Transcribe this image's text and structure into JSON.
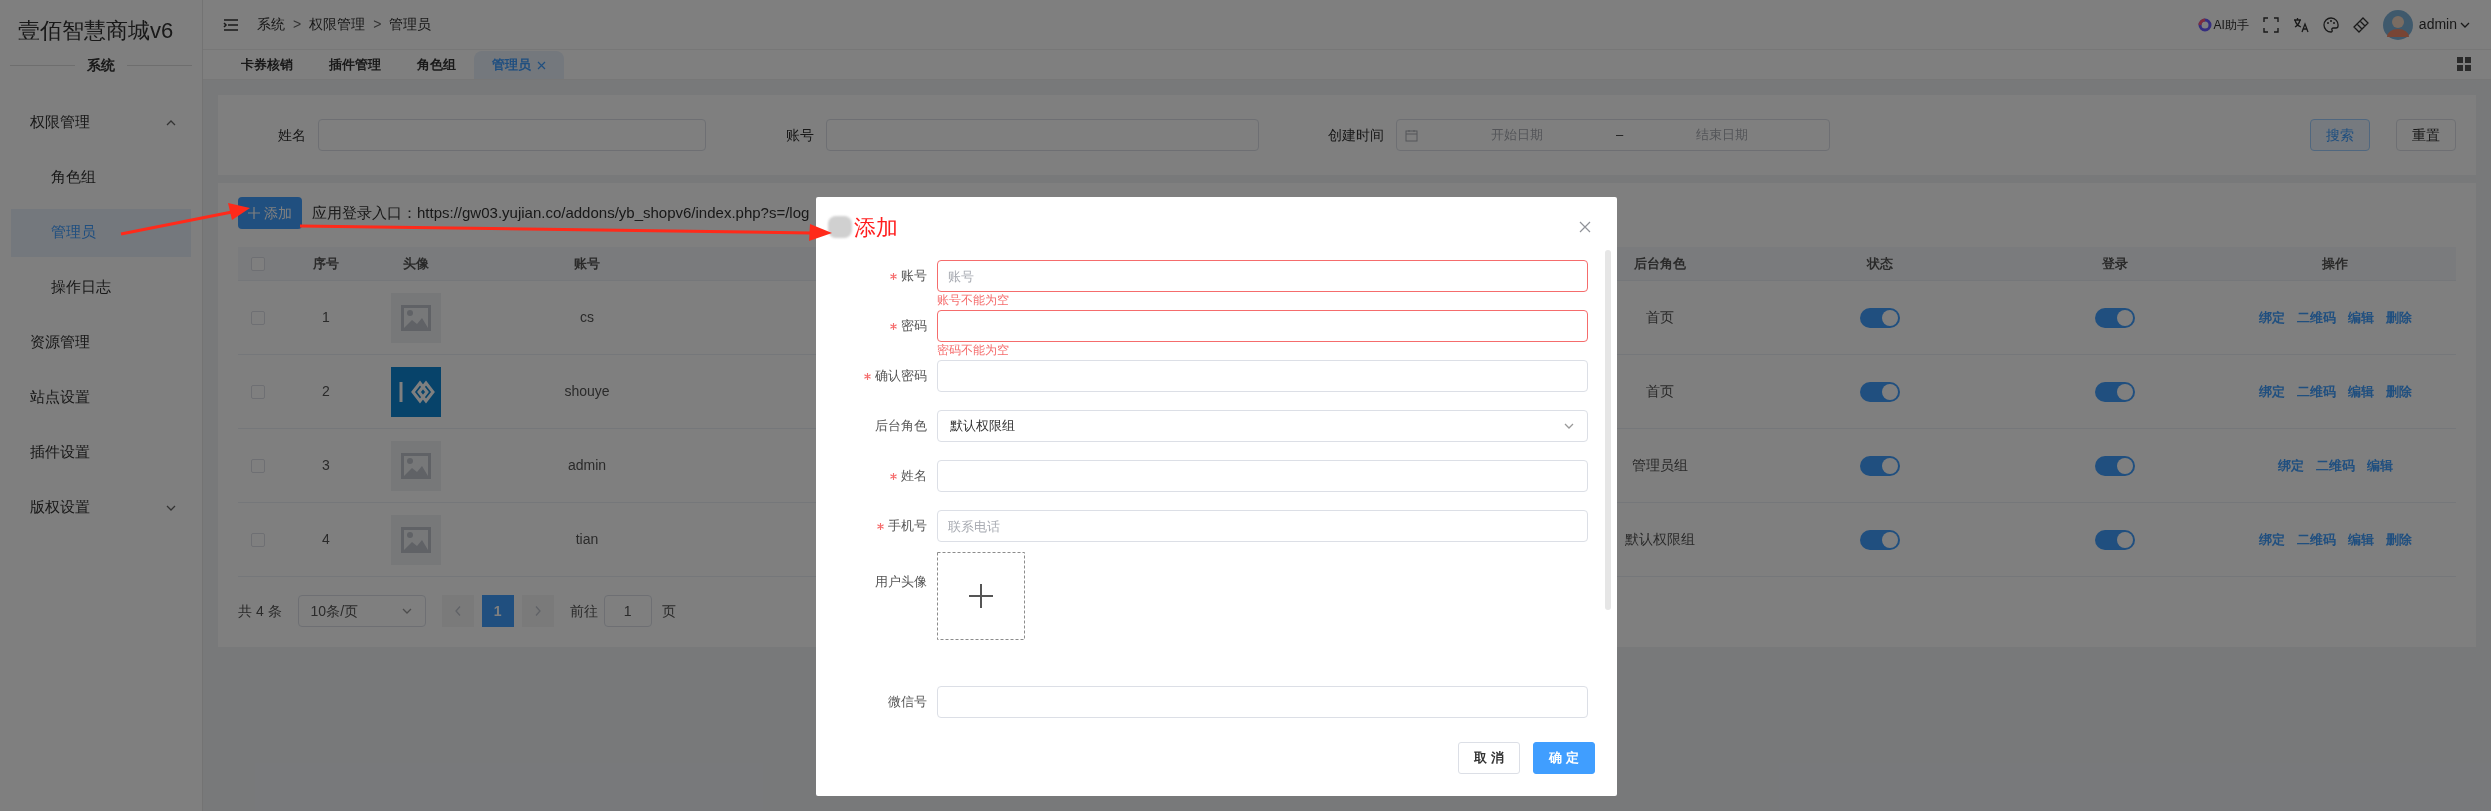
{
  "sidebar": {
    "logo": "壹佰智慧商城v6",
    "section": "系统",
    "items": [
      {
        "kind": "group",
        "label": "权限管理",
        "expanded": true,
        "children": [
          {
            "label": "角色组",
            "selected": false
          },
          {
            "label": "管理员",
            "selected": true
          },
          {
            "label": "操作日志",
            "selected": false
          }
        ]
      },
      {
        "kind": "link",
        "label": "资源管理",
        "selected": false
      },
      {
        "kind": "link",
        "label": "站点设置",
        "selected": false
      },
      {
        "kind": "link",
        "label": "插件设置",
        "selected": false
      },
      {
        "kind": "group",
        "label": "版权设置",
        "expanded": false
      }
    ]
  },
  "header": {
    "breadcrumb": [
      "系统",
      "权限管理",
      "管理员"
    ],
    "separator": ">",
    "ai_label": "AI助手",
    "user": "admin"
  },
  "tabs": [
    {
      "label": "卡券核销",
      "selected": false,
      "closable": false
    },
    {
      "label": "插件管理",
      "selected": false,
      "closable": false
    },
    {
      "label": "角色组",
      "selected": false,
      "closable": false
    },
    {
      "label": "管理员",
      "selected": true,
      "closable": true
    }
  ],
  "filters": [
    {
      "kind": "text",
      "label": "姓名"
    },
    {
      "kind": "text",
      "label": "账号"
    },
    {
      "kind": "daterange",
      "label": "创建时间",
      "start_placeholder": "开始日期",
      "separator": "–",
      "end_placeholder": "结束日期"
    }
  ],
  "filter_buttons": [
    {
      "kind": "primary",
      "label": "搜索"
    },
    {
      "kind": "default",
      "label": "重置"
    }
  ],
  "add_button": "添加",
  "login_url": "应用登录入口：https://gw03.yujian.co/addons/yb_shopv6/index.php?s=/log",
  "table": {
    "select_all_checked": false,
    "columns": [
      "序号",
      "头像",
      "账号",
      "后台角色",
      "状态",
      "登录",
      "操作"
    ],
    "rows": [
      {
        "checked": false,
        "index": "1",
        "kind": "placeholder",
        "account": "cs",
        "role": "首页",
        "status_on": true,
        "login_on": true,
        "actions": [
          "绑定",
          "二维码",
          "编辑",
          "删除"
        ]
      },
      {
        "checked": false,
        "index": "2",
        "kind": "logo",
        "account": "shouye",
        "role": "首页",
        "status_on": true,
        "login_on": true,
        "actions": [
          "绑定",
          "二维码",
          "编辑",
          "删除"
        ]
      },
      {
        "checked": false,
        "index": "3",
        "kind": "placeholder",
        "account": "admin",
        "role": "管理员组",
        "status_on": true,
        "login_on": true,
        "actions": [
          "绑定",
          "二维码",
          "编辑"
        ]
      },
      {
        "checked": false,
        "index": "4",
        "kind": "placeholder",
        "account": "tian",
        "role": "默认权限组",
        "status_on": true,
        "login_on": true,
        "actions": [
          "绑定",
          "二维码",
          "编辑",
          "删除"
        ]
      }
    ]
  },
  "pagination": {
    "total": "共 4 条",
    "page_size": "10条/页",
    "pages": [
      {
        "label": "1",
        "selected": true
      }
    ],
    "goto_label": "前往",
    "goto_value": "1",
    "page_suffix": "页"
  },
  "modal": {
    "title": "添加",
    "fields": [
      {
        "kind": "text",
        "label": "账号",
        "required": true,
        "placeholder": "账号",
        "error": "账号不能为空"
      },
      {
        "kind": "text",
        "label": "密码",
        "required": true,
        "error": "密码不能为空"
      },
      {
        "kind": "text",
        "label": "确认密码",
        "required": true
      },
      {
        "kind": "select",
        "label": "后台角色",
        "required": false,
        "value": "默认权限组"
      },
      {
        "kind": "text",
        "label": "姓名",
        "required": true
      },
      {
        "kind": "text",
        "label": "手机号",
        "required": true,
        "placeholder": "联系电话"
      },
      {
        "kind": "upload",
        "label": "用户头像",
        "required": false
      },
      {
        "kind": "text",
        "label": "微信号",
        "required": false
      }
    ],
    "buttons": [
      {
        "kind": "default",
        "label": "取 消"
      },
      {
        "kind": "primary",
        "label": "确 定"
      }
    ]
  }
}
